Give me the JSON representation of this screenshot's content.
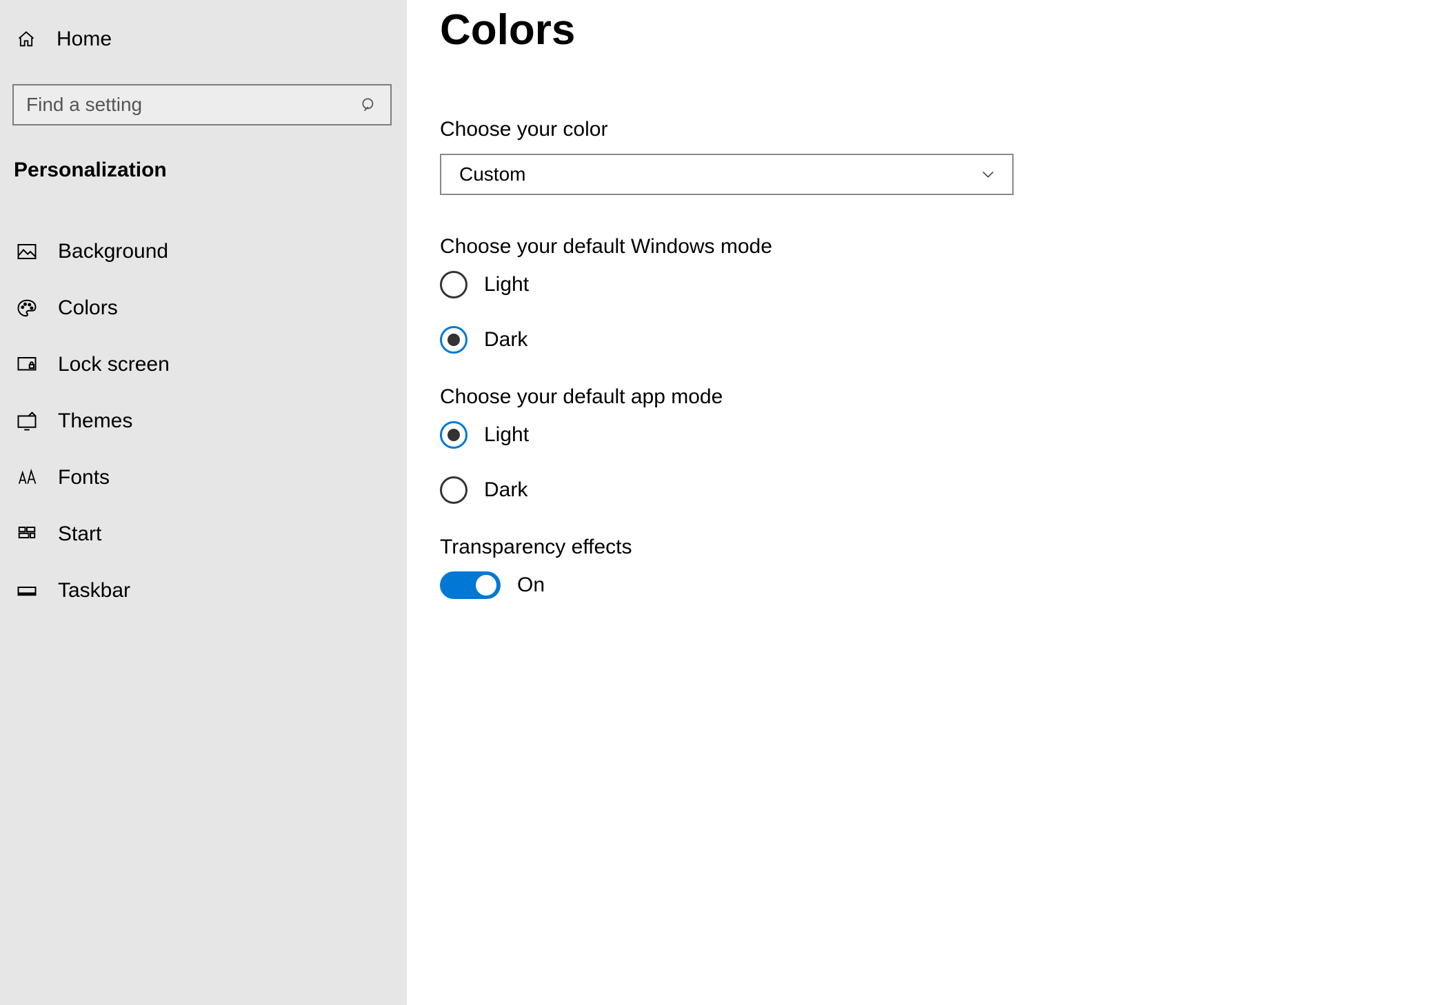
{
  "sidebar": {
    "home": "Home",
    "search_placeholder": "Find a setting",
    "section": "Personalization",
    "items": [
      {
        "key": "background",
        "label": "Background"
      },
      {
        "key": "colors",
        "label": "Colors"
      },
      {
        "key": "lockscreen",
        "label": "Lock screen"
      },
      {
        "key": "themes",
        "label": "Themes"
      },
      {
        "key": "fonts",
        "label": "Fonts"
      },
      {
        "key": "start",
        "label": "Start"
      },
      {
        "key": "taskbar",
        "label": "Taskbar"
      }
    ]
  },
  "main": {
    "title": "Colors",
    "color_label": "Choose your color",
    "color_value": "Custom",
    "windows_mode_label": "Choose your default Windows mode",
    "windows_mode_options": {
      "light": "Light",
      "dark": "Dark"
    },
    "windows_mode_selected": "dark",
    "app_mode_label": "Choose your default app mode",
    "app_mode_options": {
      "light": "Light",
      "dark": "Dark"
    },
    "app_mode_selected": "light",
    "transparency_label": "Transparency effects",
    "transparency_state": "On"
  }
}
